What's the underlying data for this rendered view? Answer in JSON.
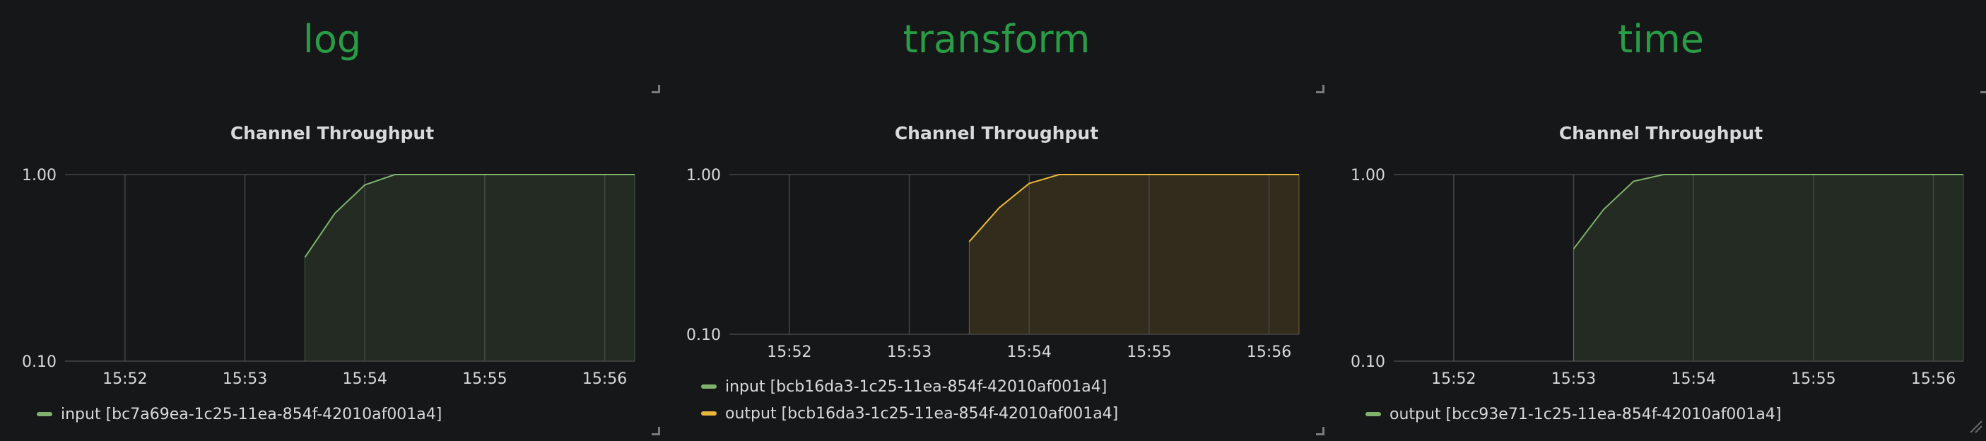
{
  "panels": [
    {
      "header_title": "log",
      "chart_data": {
        "type": "area",
        "title": "Channel Throughput",
        "xlabel": "",
        "ylabel": "",
        "y_scale": "log",
        "y_ticks": [
          "1.00",
          "0.10"
        ],
        "ylim": [
          0.1,
          1.0
        ],
        "xlim": [
          "15:51:30",
          "15:56:15"
        ],
        "x_ticks": [
          "15:52",
          "15:53",
          "15:54",
          "15:55",
          "15:56"
        ],
        "grid": true,
        "legend": "bottom-left",
        "series": [
          {
            "name": "input [bc7a69ea-1c25-11ea-854f-42010af001a4]",
            "color": "#7eb26d",
            "x": [
              "15:53:30",
              "15:53:45",
              "15:54:00",
              "15:54:15",
              "15:56:15"
            ],
            "y": [
              0.36,
              0.62,
              0.88,
              1.0,
              1.0
            ]
          }
        ]
      }
    },
    {
      "header_title": "transform",
      "chart_data": {
        "type": "area",
        "title": "Channel Throughput",
        "xlabel": "",
        "ylabel": "",
        "y_scale": "log",
        "y_ticks": [
          "1.00",
          "0.10"
        ],
        "ylim": [
          0.1,
          1.0
        ],
        "xlim": [
          "15:51:30",
          "15:56:15"
        ],
        "x_ticks": [
          "15:52",
          "15:53",
          "15:54",
          "15:55",
          "15:56"
        ],
        "grid": true,
        "legend": "bottom-left",
        "series": [
          {
            "name": "input [bcb16da3-1c25-11ea-854f-42010af001a4]",
            "color": "#7eb26d",
            "x": [],
            "y": []
          },
          {
            "name": "output [bcb16da3-1c25-11ea-854f-42010af001a4]",
            "color": "#eab839",
            "x": [
              "15:53:30",
              "15:53:45",
              "15:54:00",
              "15:54:15",
              "15:56:15"
            ],
            "y": [
              0.38,
              0.62,
              0.88,
              1.0,
              1.0
            ]
          }
        ]
      }
    },
    {
      "header_title": "time",
      "chart_data": {
        "type": "area",
        "title": "Channel Throughput",
        "xlabel": "",
        "ylabel": "",
        "y_scale": "log",
        "y_ticks": [
          "1.00",
          "0.10"
        ],
        "ylim": [
          0.1,
          1.0
        ],
        "xlim": [
          "15:51:30",
          "15:56:15"
        ],
        "x_ticks": [
          "15:52",
          "15:53",
          "15:54",
          "15:55",
          "15:56"
        ],
        "grid": true,
        "legend": "bottom-left",
        "series": [
          {
            "name": "output [bcc93e71-1c25-11ea-854f-42010af001a4]",
            "color": "#7eb26d",
            "x": [
              "15:53:00",
              "15:53:15",
              "15:53:30",
              "15:53:45",
              "15:56:15"
            ],
            "y": [
              0.4,
              0.65,
              0.92,
              1.0,
              1.0
            ]
          }
        ]
      }
    }
  ]
}
